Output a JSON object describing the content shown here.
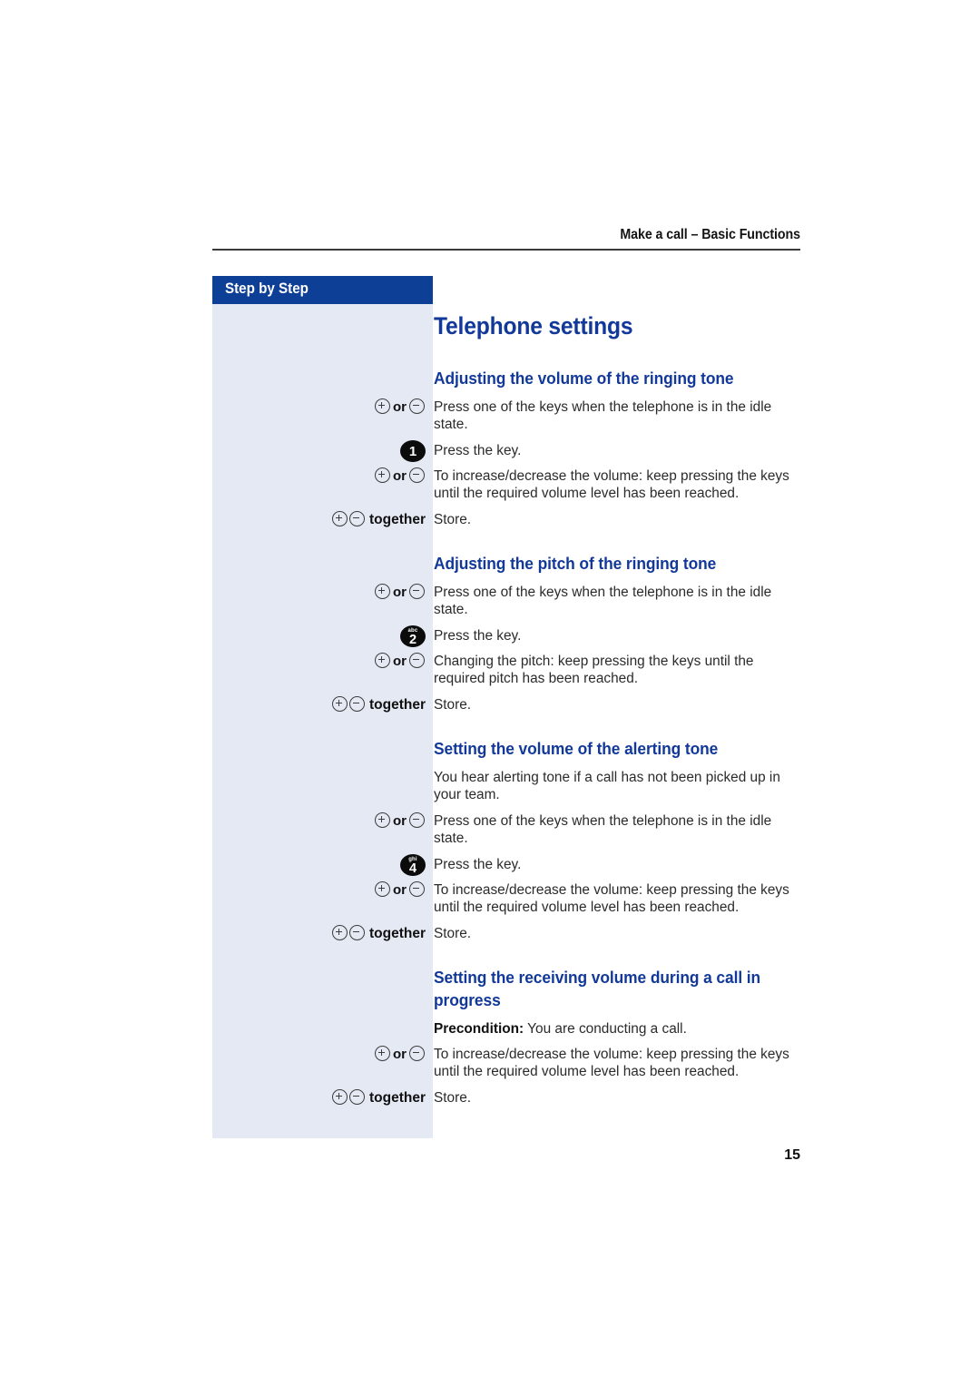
{
  "header": {
    "running_head": "Make a call – Basic Functions"
  },
  "sidebar": {
    "label": "Step by Step",
    "header_bg": "#0d3f96",
    "panel_bg": "#e4e9f4"
  },
  "document": {
    "title": "Telephone settings",
    "accent_color": "#12399a",
    "page_number": "15"
  },
  "icons": {
    "plus": "circled-plus-icon",
    "minus": "circled-minus-icon",
    "or": "or",
    "together": "together"
  },
  "sections": [
    {
      "heading": "Adjusting the volume of the ringing tone",
      "rows": [
        {
          "label_type": "plus-or-minus",
          "body": "Press one of the keys when the telephone is in the idle state."
        },
        {
          "label_type": "numkey",
          "key_digit": "1",
          "key_letters": "",
          "body": "Press the key."
        },
        {
          "label_type": "plus-or-minus",
          "body": "To increase/decrease the volume: keep pressing the keys until the required volume level has been reached."
        },
        {
          "label_type": "plus-minus-together",
          "body": "Store."
        }
      ]
    },
    {
      "heading": "Adjusting the pitch of the ringing tone",
      "rows": [
        {
          "label_type": "plus-or-minus",
          "body": "Press one of the keys when the telephone is in the idle state."
        },
        {
          "label_type": "numkey",
          "key_digit": "2",
          "key_letters": "abc",
          "body": "Press the key."
        },
        {
          "label_type": "plus-or-minus",
          "body": "Changing the pitch: keep pressing the keys until the required pitch has been reached."
        },
        {
          "label_type": "plus-minus-together",
          "body": "Store."
        }
      ]
    },
    {
      "heading": "Setting the volume of the alerting tone",
      "rows": [
        {
          "label_type": "none",
          "body": "You hear alerting tone if a call has not been picked up in your team."
        },
        {
          "label_type": "plus-or-minus",
          "body": "Press one of the keys when the telephone is in the idle state."
        },
        {
          "label_type": "numkey",
          "key_digit": "4",
          "key_letters": "ghi",
          "body": "Press the key."
        },
        {
          "label_type": "plus-or-minus",
          "body": "To increase/decrease the volume: keep pressing the keys until the required volume level has been reached."
        },
        {
          "label_type": "plus-minus-together",
          "body": "Store."
        }
      ]
    },
    {
      "heading": "Setting the receiving volume during a call in progress",
      "rows": [
        {
          "label_type": "none",
          "body_bold": "Precondition:",
          "body": " You are conducting a call."
        },
        {
          "label_type": "plus-or-minus",
          "body": "To increase/decrease the volume: keep pressing the keys until the required volume level has been reached."
        },
        {
          "label_type": "plus-minus-together",
          "body": "Store."
        }
      ]
    }
  ]
}
